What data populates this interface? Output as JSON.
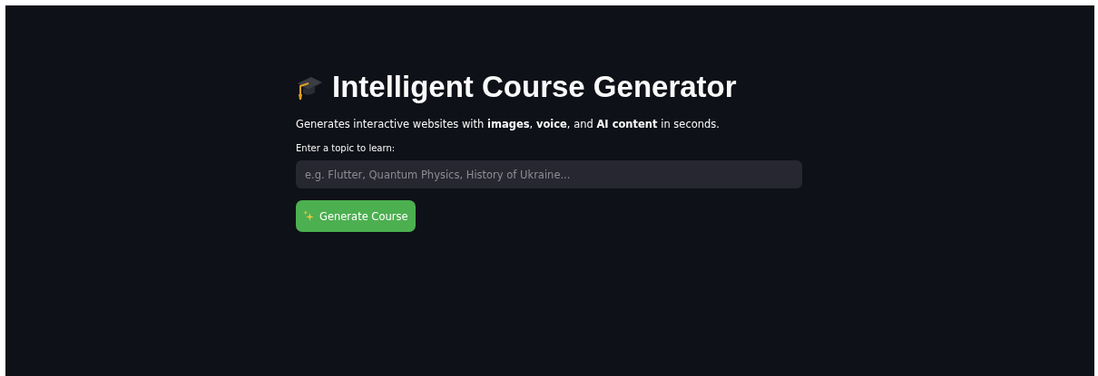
{
  "title": "Intelligent Course Generator",
  "subtitle": "Generates interactive websites with **images**, **voice**, and **AI content** in seconds.",
  "topic_field": {
    "label": "Enter a topic to learn:",
    "placeholder": "e.g. Flutter, Quantum Physics, History of Ukraine..."
  },
  "generate_button": {
    "label": "Generate Course"
  }
}
